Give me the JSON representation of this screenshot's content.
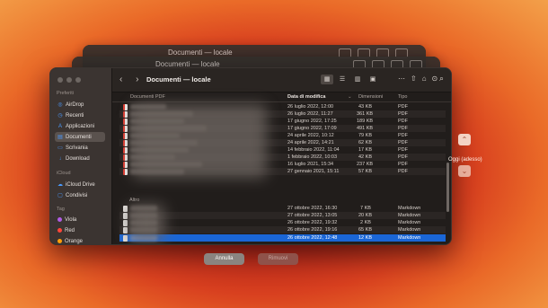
{
  "ghost_windows": [
    {
      "title": "Documenti — locale"
    },
    {
      "title": "Documenti — locale"
    }
  ],
  "window": {
    "title": "Documenti — locale",
    "nav_buttons": "‹ ›",
    "toolbar_icons": {
      "views": [
        "▦",
        "☰",
        "▥",
        "▣"
      ],
      "group": "⋯",
      "share": "⇧",
      "tag": "⌂",
      "action": "⊙",
      "search": "⌕"
    }
  },
  "sidebar": {
    "sections": {
      "favorites": "Preferiti",
      "icloud": "iCloud",
      "tags": "Tag"
    },
    "favorites": [
      {
        "label": "AirDrop",
        "icon": "airdrop-icon",
        "glyph": "◎"
      },
      {
        "label": "Recenti",
        "icon": "clock-icon",
        "glyph": "◷"
      },
      {
        "label": "Applicazioni",
        "icon": "applications-icon",
        "glyph": "A"
      },
      {
        "label": "Documenti",
        "icon": "document-icon",
        "glyph": "▤"
      },
      {
        "label": "Scrivania",
        "icon": "desktop-icon",
        "glyph": "▭"
      },
      {
        "label": "Download",
        "icon": "download-icon",
        "glyph": "↓"
      }
    ],
    "icloud": [
      {
        "label": "iCloud Drive",
        "icon": "cloud-icon",
        "glyph": "☁"
      },
      {
        "label": "Condivisi",
        "icon": "shared-folder-icon",
        "glyph": "▢"
      }
    ],
    "tags": [
      {
        "label": "Viola",
        "color": "#b15de6"
      },
      {
        "label": "Red",
        "color": "#ff453a"
      },
      {
        "label": "Orange",
        "color": "#ff9f0a"
      }
    ]
  },
  "columns": {
    "name": "Documenti PDF",
    "date": "Data di modifica",
    "size": "Dimensioni",
    "kind": "Tipo"
  },
  "pdf_rows": [
    {
      "date": "26 luglio 2022, 12:00",
      "size": "43 KB",
      "kind": "PDF"
    },
    {
      "date": "26 luglio 2022, 11:27",
      "size": "361 KB",
      "kind": "PDF"
    },
    {
      "date": "17 giugno 2022, 17:25",
      "size": "189 KB",
      "kind": "PDF"
    },
    {
      "date": "17 giugno 2022, 17:09",
      "size": "491 KB",
      "kind": "PDF"
    },
    {
      "date": "24 aprile 2022, 10:12",
      "size": "79 KB",
      "kind": "PDF"
    },
    {
      "date": "24 aprile 2022, 14:21",
      "size": "62 KB",
      "kind": "PDF"
    },
    {
      "date": "14 febbraio 2022, 11:04",
      "size": "17 KB",
      "kind": "PDF"
    },
    {
      "date": "1 febbraio 2022, 10:03",
      "size": "42 KB",
      "kind": "PDF"
    },
    {
      "date": "16 luglio 2021, 15:34",
      "size": "237 KB",
      "kind": "PDF"
    },
    {
      "date": "27 gennaio 2021, 15:11",
      "size": "57 KB",
      "kind": "PDF"
    }
  ],
  "group_other": "Altro",
  "md_rows": [
    {
      "date": "27 ottobre 2022, 16:30",
      "size": "7 KB",
      "kind": "Markdown"
    },
    {
      "date": "27 ottobre 2022, 13:05",
      "size": "20 KB",
      "kind": "Markdown"
    },
    {
      "date": "26 ottobre 2022, 19:32",
      "size": "2 KB",
      "kind": "Markdown"
    },
    {
      "date": "26 ottobre 2022, 19:16",
      "size": "65 KB",
      "kind": "Markdown"
    },
    {
      "date": "26 ottobre 2022, 12:48",
      "size": "12 KB",
      "kind": "Markdown",
      "selected": true
    }
  ],
  "buttons": {
    "cancel": "Annulla",
    "remove": "Rimuovi"
  },
  "time_machine": {
    "up": "⌃",
    "down": "⌄",
    "label": "Oggi (adesso)"
  }
}
